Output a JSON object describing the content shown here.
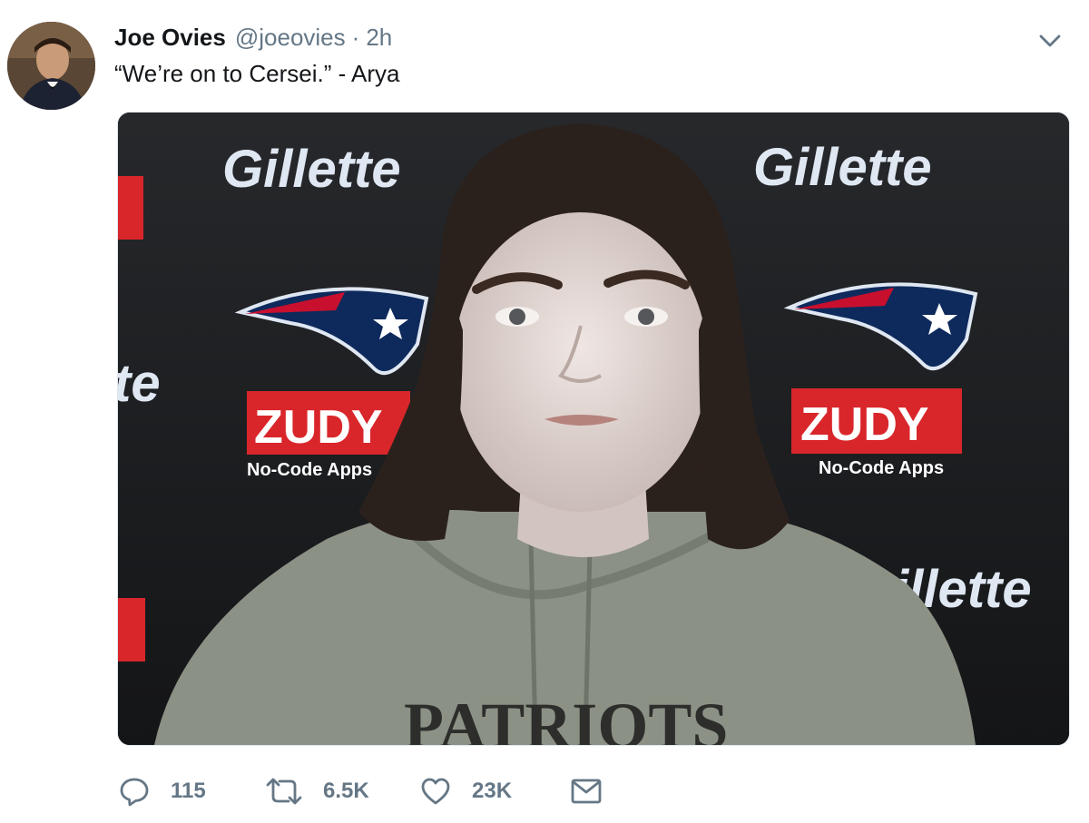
{
  "tweet": {
    "author_name": "Joe Ovies",
    "handle": "@joeovies",
    "separator": "·",
    "time": "2h",
    "text": "“We’re on to Cersei.” - Arya"
  },
  "media": {
    "backdrop_brand": "Gillette",
    "backdrop_sponsor": "ZUDY",
    "backdrop_sponsor_tagline": "No-Code Apps",
    "sweatshirt_text": "PATRIOTS",
    "backdrop_color": "#1b1c1e",
    "sweatshirt_color": "#8c9185"
  },
  "actions": {
    "reply": {
      "icon": "reply-icon",
      "count": "115"
    },
    "retweet": {
      "icon": "retweet-icon",
      "count": "6.5K"
    },
    "like": {
      "icon": "heart-icon",
      "count": "23K"
    },
    "dm": {
      "icon": "envelope-icon"
    }
  },
  "colors": {
    "text": "#14171a",
    "secondary": "#657786"
  }
}
